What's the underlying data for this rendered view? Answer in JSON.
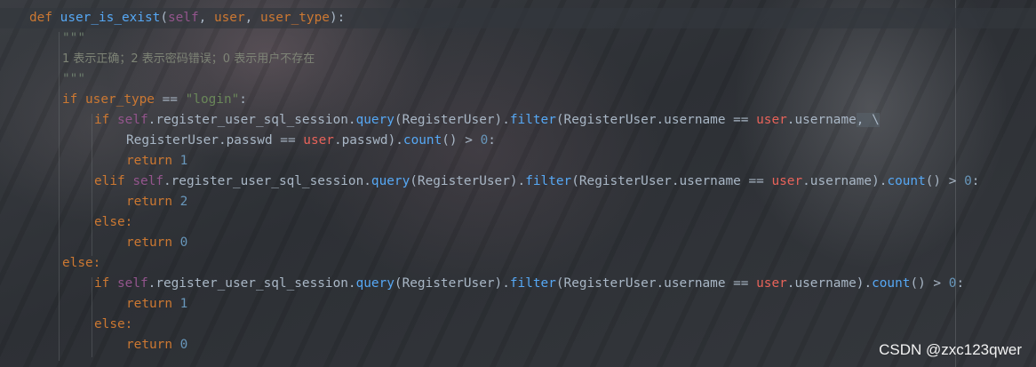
{
  "code": {
    "def_kw": "def",
    "func_name": "user_is_exist",
    "open_paren": "(",
    "self": "self",
    "comma_sp": ", ",
    "param_user": "user",
    "param_user_type": "user_type",
    "close_sig": "):",
    "docstring_quotes": "\"\"\"",
    "docstring_text": "1 表示正确；2 表示密码错误；0 表示用户不存在",
    "if_kw": "if",
    "elif_kw": "elif",
    "else_kw": "else:",
    "return_kw": "return",
    "user_type_var": "user_type",
    "eq_op": " == ",
    "login_str": "\"login\"",
    "colon": ":",
    "session_attr": ".register_user_sql_session.",
    "query_fn": "query",
    "register_user_arg": "(RegisterUser).",
    "filter_fn": "filter",
    "filter_arg_start": "(RegisterUser.username == ",
    "user_var": "user",
    "username_attr": ".username",
    "comma": ",",
    "space": " ",
    "backslash": "\\",
    "passwd_cond": "RegisterUser.passwd == ",
    "passwd_attr": ".passwd).",
    "count_fn": "count",
    "count_tail": "() > ",
    "zero_colon_num": "0",
    "close_paren_dot": ").",
    "num_1": "1",
    "num_2": "2",
    "num_0": "0"
  },
  "watermark": "CSDN @zxc123qwer",
  "colors": {
    "keyword": "#cc7832",
    "function": "#56a8f5",
    "self": "#94558d",
    "string": "#6a8759",
    "number": "#6897bb",
    "variable_red": "#e8635a",
    "text": "#a9b7c6"
  }
}
